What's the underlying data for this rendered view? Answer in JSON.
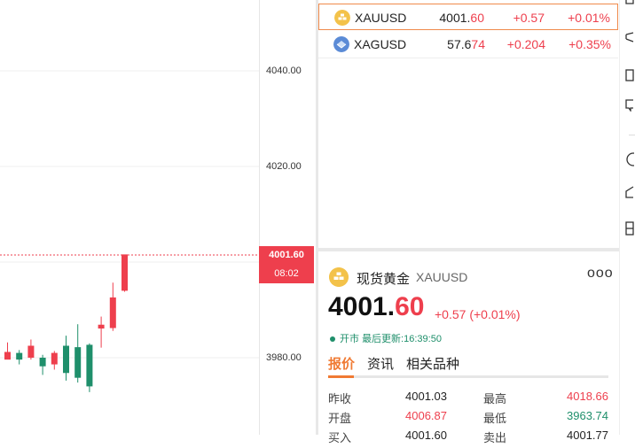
{
  "axis": {
    "ticks": [
      {
        "label": "4040.00"
      },
      {
        "label": "4020.00"
      },
      {
        "label": "3980.00"
      }
    ]
  },
  "price_tag": {
    "price": "4001.60",
    "time": "08:02"
  },
  "watchlist": [
    {
      "symbol": "XAUUSD",
      "price_main": "4001.",
      "price_tail": "60",
      "change": "+0.57",
      "percent": "+0.01%",
      "icon": "gold-icon",
      "selected": true
    },
    {
      "symbol": "XAGUSD",
      "price_main": "57.6",
      "price_tail": "74",
      "change": "+0.204",
      "percent": "+0.35%",
      "icon": "silver-icon",
      "selected": false
    }
  ],
  "detail": {
    "name": "现货黄金",
    "code": "XAUUSD",
    "more": "ooo",
    "price_main": "4001.",
    "price_tail": "60",
    "change": "+0.57 (+0.01%)",
    "status_open": "开市",
    "status_update": "最后更新:16:39:50",
    "tabs": [
      "报价",
      "资讯",
      "相关品种"
    ],
    "stats": [
      {
        "l1": "昨收",
        "v1": "4001.03",
        "l2": "最高",
        "v2": "4018.66"
      },
      {
        "l1": "开盘",
        "v1": "4006.87",
        "l2": "最低",
        "v2": "3963.74"
      },
      {
        "l1": "买入",
        "v1": "4001.60",
        "l2": "卖出",
        "v2": "4001.77"
      }
    ]
  },
  "colors": {
    "up": "#ee3f4d",
    "down": "#1f8f6b",
    "accent": "#f07a33"
  }
}
